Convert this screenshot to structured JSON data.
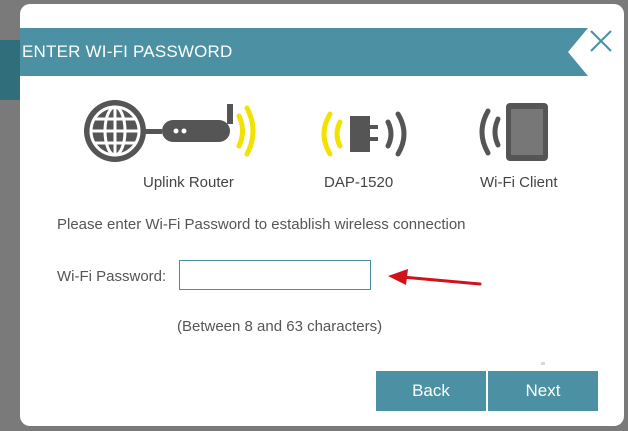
{
  "dialog": {
    "title": "ENTER WI-FI PASSWORD",
    "close_icon": "close-icon"
  },
  "devices": [
    {
      "label": "Uplink Router",
      "icon": "router-icon"
    },
    {
      "label": "DAP-1520",
      "icon": "extender-icon"
    },
    {
      "label": "Wi-Fi Client",
      "icon": "tablet-icon"
    }
  ],
  "instruction": "Please enter Wi-Fi Password to establish wireless connection",
  "password": {
    "label": "Wi-Fi Password:",
    "value": "",
    "placeholder": ""
  },
  "hint": "(Between 8 and 63 characters)",
  "buttons": {
    "back": "Back",
    "next": "Next"
  },
  "colors": {
    "accent": "#4b91a3",
    "signal_active": "#f2e200",
    "signal_inactive": "#555555",
    "pointer_arrow": "#d0121b"
  }
}
